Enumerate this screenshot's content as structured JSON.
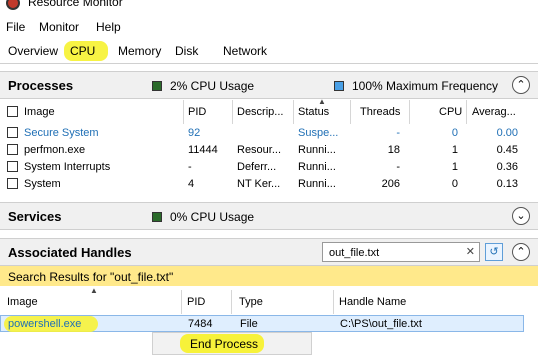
{
  "window": {
    "title": "Resource Monitor"
  },
  "menu": [
    "File",
    "Monitor",
    "Help"
  ],
  "tabs": [
    "Overview",
    "CPU",
    "Memory",
    "Disk",
    "Network"
  ],
  "processes": {
    "title": "Processes",
    "cpu_usage": "2% CPU Usage",
    "max_freq": "100% Maximum Frequency",
    "columns": [
      "Image",
      "PID",
      "Descrip...",
      "Status",
      "Threads",
      "CPU",
      "Averag..."
    ],
    "rows": [
      {
        "image": "Secure System",
        "pid": "92",
        "desc": "",
        "status": "Suspe...",
        "threads": "-",
        "cpu": "0",
        "avg": "0.00"
      },
      {
        "image": "perfmon.exe",
        "pid": "11444",
        "desc": "Resour...",
        "status": "Runni...",
        "threads": "18",
        "cpu": "1",
        "avg": "0.45"
      },
      {
        "image": "System Interrupts",
        "pid": "-",
        "desc": "Deferr...",
        "status": "Runni...",
        "threads": "-",
        "cpu": "1",
        "avg": "0.36"
      },
      {
        "image": "System",
        "pid": "4",
        "desc": "NT Ker...",
        "status": "Runni...",
        "threads": "206",
        "cpu": "0",
        "avg": "0.13"
      }
    ]
  },
  "services": {
    "title": "Services",
    "cpu_usage": "0% CPU Usage"
  },
  "handles": {
    "title": "Associated Handles",
    "search_value": "out_file.txt",
    "results_text": "Search Results for \"out_file.txt\"",
    "columns": [
      "Image",
      "PID",
      "Type",
      "Handle Name"
    ],
    "row": {
      "image": "powershell.exe",
      "pid": "7484",
      "type": "File",
      "name": "C:\\PS\\out_file.txt"
    },
    "context_menu_item": "End Process"
  },
  "colors": {
    "highlight": "#f7f23a",
    "link_blue": "#1f6fb5",
    "results_yellow": "#ffe98b",
    "selected_row": "#dfeefe"
  }
}
